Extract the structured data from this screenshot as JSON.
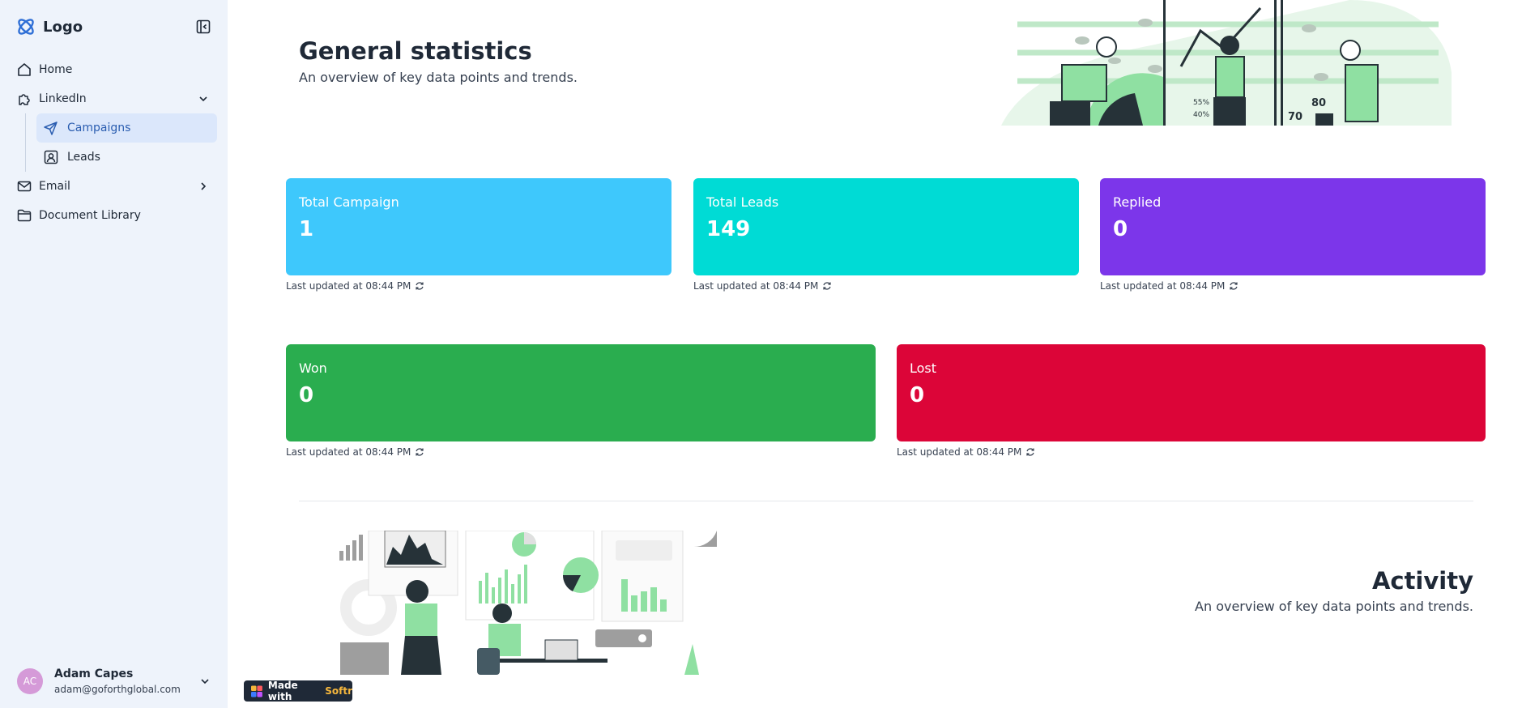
{
  "app": {
    "logo_text": "Logo"
  },
  "sidebar": {
    "items": [
      {
        "label": "Home",
        "icon": "home-icon"
      },
      {
        "label": "LinkedIn",
        "icon": "puzzle-icon"
      },
      {
        "label": "Campaigns",
        "icon": "send-icon"
      },
      {
        "label": "Leads",
        "icon": "contact-icon"
      },
      {
        "label": "Email",
        "icon": "mail-icon"
      },
      {
        "label": "Document Library",
        "icon": "folder-icon"
      }
    ]
  },
  "user": {
    "initials": "AC",
    "name": "Adam Capes",
    "email": "adam@goforthglobal.com"
  },
  "header": {
    "title": "General statistics",
    "subtitle": "An overview of key data points and trends."
  },
  "stats": [
    {
      "label": "Total Campaign",
      "value": "1",
      "updated": "Last updated at 08:44 PM",
      "color": "#3ec8fc"
    },
    {
      "label": "Total Leads",
      "value": "149",
      "updated": "Last updated at 08:44 PM",
      "color": "#00dbd5"
    },
    {
      "label": "Replied",
      "value": "0",
      "updated": "Last updated at 08:44 PM",
      "color": "#7c36ea"
    },
    {
      "label": "Won",
      "value": "0",
      "updated": "Last updated at 08:44 PM",
      "color": "#2aad4f"
    },
    {
      "label": "Lost",
      "value": "0",
      "updated": "Last updated at 08:44 PM",
      "color": "#dc0538"
    }
  ],
  "illustration": {
    "labels": [
      "55%",
      "40%",
      "70",
      "80"
    ]
  },
  "activity": {
    "title": "Activity",
    "subtitle": "An overview of key data points and trends."
  },
  "softr_badge": {
    "prefix": "Made with",
    "brand": "Softr"
  },
  "colors": {
    "sidebar_bg": "#eef3fb",
    "active_bg": "#dbe7fb",
    "active_text": "#2a5db0",
    "accent_green": "#8fe0a2"
  }
}
